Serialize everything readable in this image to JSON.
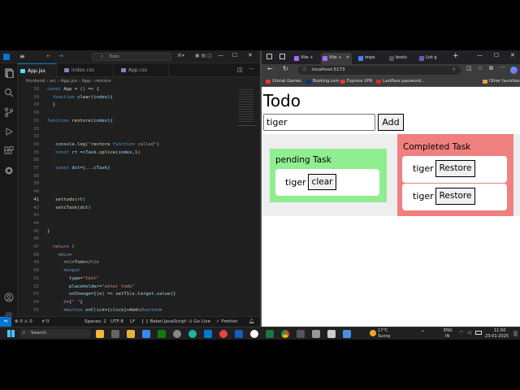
{
  "vscode": {
    "search_text": "Todo",
    "tabs": [
      {
        "label": "App.jsx"
      },
      {
        "label": "index.css"
      },
      {
        "label": "App.css"
      }
    ],
    "breadcrumb": "frontend  ›  src  ›  App.jsx  ›  App  ›  restore",
    "lines": [
      {
        "n": "28",
        "t": "const App = () => {"
      },
      {
        "n": "19",
        "t": "  function clear(index){"
      },
      {
        "n": "29",
        "t": "  }"
      },
      {
        "n": "30",
        "t": ""
      },
      {
        "n": "31",
        "t": "function restore(index){"
      },
      {
        "n": "32",
        "t": ""
      },
      {
        "n": "33",
        "t": ""
      },
      {
        "n": "34",
        "t": "   console.log(\"restore function called\")"
      },
      {
        "n": "35",
        "t": "   const rt =cTask.splice(index,1)"
      },
      {
        "n": "36",
        "t": ""
      },
      {
        "n": "37",
        "t": "   const dct=[...cTask]"
      },
      {
        "n": "38",
        "t": ""
      },
      {
        "n": "39",
        "t": ""
      },
      {
        "n": "40",
        "t": ""
      },
      {
        "n": "41",
        "t": "   settodo(rt)"
      },
      {
        "n": "42",
        "t": "   setcTask(dct)"
      },
      {
        "n": "43",
        "t": ""
      },
      {
        "n": "44",
        "t": ""
      },
      {
        "n": "45",
        "t": "}"
      },
      {
        "n": "46",
        "t": ""
      },
      {
        "n": "47",
        "t": "  return ("
      },
      {
        "n": "48",
        "t": "    <div>"
      },
      {
        "n": "49",
        "t": "      <h1>Todo</h1>"
      },
      {
        "n": "50",
        "t": "      <input"
      },
      {
        "n": "51",
        "t": "        type=\"text\""
      },
      {
        "n": "52",
        "t": "        placeholder=\"enter todo\""
      },
      {
        "n": "53",
        "t": "        onChange={(e) => setT1(e.target.value)}"
      },
      {
        "n": "54",
        "t": "      />{\" \"}"
      },
      {
        "n": "55",
        "t": "      <button onClick={click}>Add</button>"
      }
    ],
    "status": {
      "problems": "⊗ 0  ⚠ 0",
      "ports": "⑈ 0",
      "spaces": "Spaces: 2",
      "encoding": "UTF-8",
      "eol": "LF",
      "lang": "{ } Babel JavaScript",
      "golive": "⊙ Go Live",
      "prettier": "✓ Prettier"
    }
  },
  "browser": {
    "tabs": [
      {
        "label": "Vite +"
      },
      {
        "label": "Vite +"
      },
      {
        "label": "impo"
      },
      {
        "label": "boots"
      },
      {
        "label": "List g"
      }
    ],
    "url": "localhost:5173",
    "bookmarks": [
      {
        "label": "Utorak Games"
      },
      {
        "label": "Booking.com"
      },
      {
        "label": "Express VPN"
      },
      {
        "label": "LastPass password..."
      }
    ],
    "other_bookmarks": "Other favorites"
  },
  "app": {
    "title": "Todo",
    "input_value": "tiger",
    "add_label": "Add",
    "pending_title": "pending Task",
    "pending_items": [
      {
        "text": "tiger",
        "action": "clear"
      }
    ],
    "completed_title": "Completed Task",
    "completed_items": [
      {
        "text": "tiger",
        "action": "Restore"
      },
      {
        "text": "tiger",
        "action": "Restore"
      }
    ]
  },
  "taskbar": {
    "search_placeholder": "Search",
    "weather_temp": "17°C",
    "weather_desc": "Sunny",
    "lang_top": "ENG",
    "lang_bottom": "IN",
    "time": "11:50",
    "date": "23-01-2025"
  },
  "colors": {
    "pending_bg": "#90ee90",
    "completed_bg": "#f08080",
    "vscode_accent": "#0078d4"
  }
}
